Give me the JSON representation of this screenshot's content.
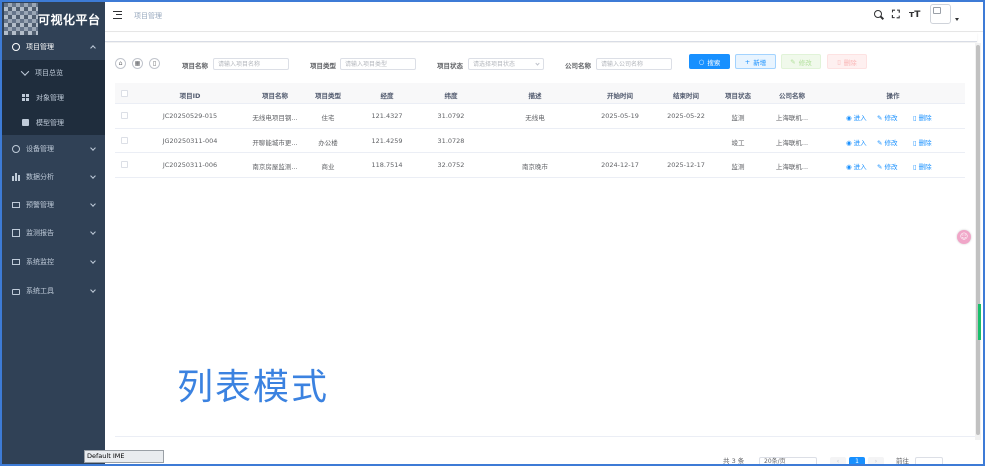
{
  "app": {
    "title": "可视化平台"
  },
  "sidebar": {
    "items": [
      {
        "label": "项目管理",
        "icon": "gear-icon",
        "expanded": true,
        "children": [
          {
            "label": "项目总览",
            "icon": "chevron-down-icon"
          },
          {
            "label": "对象管理",
            "icon": "grid-icon"
          },
          {
            "label": "模型管理",
            "icon": "book-icon"
          }
        ]
      },
      {
        "label": "设备管理",
        "icon": "gear-icon"
      },
      {
        "label": "数据分析",
        "icon": "bar-chart-icon"
      },
      {
        "label": "预警管理",
        "icon": "monitor-icon"
      },
      {
        "label": "监测报告",
        "icon": "book-icon"
      },
      {
        "label": "系统监控",
        "icon": "monitor-icon"
      },
      {
        "label": "系统工具",
        "icon": "briefcase-icon"
      }
    ]
  },
  "header": {
    "breadcrumb": "项目管理"
  },
  "search_form": {
    "project_name_label": "项目名称",
    "project_name_placeholder": "请输入项目名称",
    "project_type_label": "项目类型",
    "project_type_placeholder": "请输入项目类型",
    "project_status_label": "项目状态",
    "project_status_placeholder": "请选择项目状态",
    "company_label": "公司名称",
    "company_placeholder": "请输入公司名称"
  },
  "toolbar": {
    "search": "搜索",
    "add": "新增",
    "edit": "修改",
    "delete": "删除"
  },
  "table": {
    "columns": [
      "项目ID",
      "项目名称",
      "项目类型",
      "经度",
      "纬度",
      "描述",
      "开始时间",
      "结束时间",
      "项目状态",
      "公司名称",
      "操作"
    ],
    "rows": [
      {
        "id": "JC20250529-015",
        "name": "无线电项目钢...",
        "type": "住宅",
        "lng": "121.4327",
        "lat": "31.0792",
        "desc": "无线电",
        "start": "2025-05-19",
        "end": "2025-05-22",
        "status": "监测",
        "company": "上海联机..."
      },
      {
        "id": "JG20250311-004",
        "name": "开聊能城市更...",
        "type": "办公楼",
        "lng": "121.4259",
        "lat": "31.0728",
        "desc": "",
        "start": "",
        "end": "",
        "status": "竣工",
        "company": "上海联机..."
      },
      {
        "id": "JC20250311-006",
        "name": "南京房屋监测...",
        "type": "商业",
        "lng": "118.7514",
        "lat": "32.0752",
        "desc": "南京晚市",
        "start": "2024-12-17",
        "end": "2025-12-17",
        "status": "监测",
        "company": "上海联机..."
      }
    ],
    "actions": {
      "enter": "进入",
      "edit": "修改",
      "delete": "删除"
    }
  },
  "watermark": "列表模式",
  "pagination": {
    "total_text": "共 3 条",
    "page_size": "20条/页",
    "current_page": "1",
    "goto": "前往"
  },
  "ime": "Default IME",
  "colors": {
    "sidebar": "#304156",
    "primary": "#1890ff",
    "frame": "#3d7bd6"
  }
}
